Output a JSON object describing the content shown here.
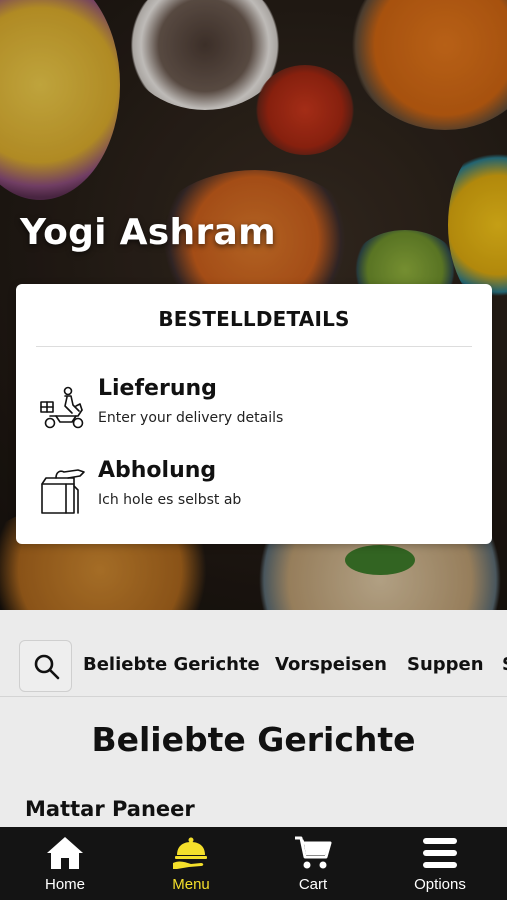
{
  "restaurant": {
    "name": "Yogi Ashram"
  },
  "order_details": {
    "title": "BESTELLDETAILS",
    "options": [
      {
        "icon": "delivery-scooter-icon",
        "title": "Lieferung",
        "subtitle": "Enter your delivery details"
      },
      {
        "icon": "takeaway-bag-icon",
        "title": "Abholung",
        "subtitle": "Ich hole es selbst ab"
      }
    ]
  },
  "categories": {
    "search_icon": "search-icon",
    "items": [
      "Beliebte Gerichte",
      "Vorspeisen",
      "Suppen",
      "S"
    ]
  },
  "section": {
    "title": "Beliebte Gerichte"
  },
  "dishes": [
    {
      "name": "Mattar Paneer"
    }
  ],
  "bottom_nav": {
    "items": [
      {
        "label": "Home",
        "icon": "home-icon"
      },
      {
        "label": "Menu",
        "icon": "serving-cloche-icon",
        "active": true
      },
      {
        "label": "Cart",
        "icon": "cart-icon"
      },
      {
        "label": "Options",
        "icon": "hamburger-menu-icon"
      }
    ],
    "active_color": "#f4df2b"
  }
}
